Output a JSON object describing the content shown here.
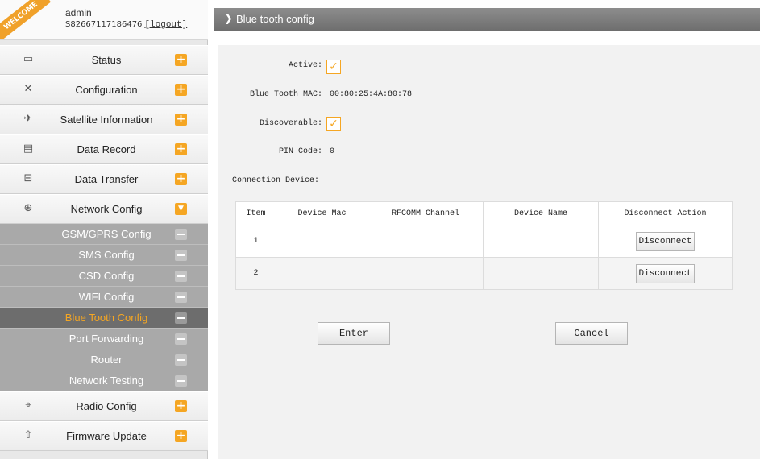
{
  "user": {
    "welcome": "WELCOME",
    "name": "admin",
    "serial": "S82667117186476",
    "logout": "[logout]"
  },
  "menu": [
    {
      "label": "Status",
      "icon": "monitor-icon",
      "glyph": "▭"
    },
    {
      "label": "Configuration",
      "icon": "tools-icon",
      "glyph": "✕"
    },
    {
      "label": "Satellite Information",
      "icon": "satellite-icon",
      "glyph": "✈"
    },
    {
      "label": "Data Record",
      "icon": "calendar-icon",
      "glyph": "▤"
    },
    {
      "label": "Data Transfer",
      "icon": "network-icon",
      "glyph": "⊟"
    },
    {
      "label": "Network Config",
      "icon": "globe-icon",
      "glyph": "⊕"
    }
  ],
  "submenu": [
    {
      "label": "GSM/GPRS Config"
    },
    {
      "label": "SMS Config"
    },
    {
      "label": "CSD Config"
    },
    {
      "label": "WIFI Config"
    },
    {
      "label": "Blue Tooth Config"
    },
    {
      "label": "Port Forwarding"
    },
    {
      "label": "Router"
    },
    {
      "label": "Network Testing"
    }
  ],
  "menu_bottom": [
    {
      "label": "Radio Config",
      "icon": "radio-icon",
      "glyph": "⌖"
    },
    {
      "label": "Firmware Update",
      "icon": "upload-icon",
      "glyph": "⇧"
    }
  ],
  "toggle": {
    "plus": "+",
    "minus": "−"
  },
  "page": {
    "title": "Blue tooth config",
    "chevron": "❯"
  },
  "form": {
    "active_label": "Active:",
    "active_checked": true,
    "mac_label": "Blue Tooth MAC:",
    "mac_value": "00:80:25:4A:80:78",
    "discoverable_label": "Discoverable:",
    "discoverable_checked": true,
    "pin_label": "PIN Code:",
    "pin_value": "0",
    "connection_label": "Connection Device:",
    "checkmark": "✓"
  },
  "table": {
    "headers": [
      "Item",
      "Device Mac",
      "RFCOMM Channel",
      "Device Name",
      "Disconnect Action"
    ],
    "rows": [
      {
        "item": "1",
        "mac": "",
        "channel": "",
        "name": "",
        "action": "Disconnect"
      },
      {
        "item": "2",
        "mac": "",
        "channel": "",
        "name": "",
        "action": "Disconnect"
      }
    ]
  },
  "buttons": {
    "enter": "Enter",
    "cancel": "Cancel"
  },
  "colors": {
    "accent": "#f5a623",
    "titlebar": "#7a7a7a",
    "submenu": "#a9a9a9",
    "submenu_active": "#6d6d6d"
  }
}
